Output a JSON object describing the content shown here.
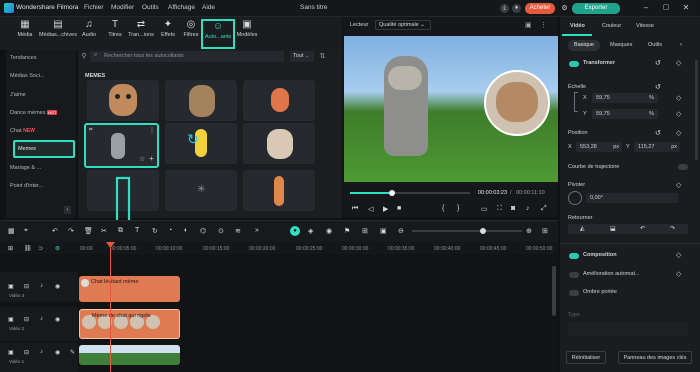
{
  "titlebar": {
    "app_name": "Wondershare Filmora",
    "menus": [
      "Fichier",
      "Modifier",
      "Outils",
      "Affichage",
      "Aide"
    ],
    "doc_title": "Sans titre",
    "buy_label": "Acheter",
    "account_label": "Exporter"
  },
  "toolbar": {
    "items": [
      "Média",
      "Médias...chives",
      "Audio",
      "Titres",
      "Tran...ions",
      "Effets",
      "Filtres",
      "Auto...ants",
      "Modèles"
    ]
  },
  "leftnav": {
    "items": [
      "Tendances",
      "Médias Soci...",
      "J'aime",
      "Dance mèmes",
      "Chat",
      "Memes",
      "Mariage & ...",
      "Point d'inter..."
    ],
    "new_badge": "NEW",
    "hot_badge": "HOT"
  },
  "content": {
    "search_placeholder": "Rechercher tous les autocollants",
    "filter_label": "Tout",
    "section_label": "MEMES"
  },
  "preview": {
    "player_label": "Lecteur",
    "quality_label": "Qualité optimale",
    "current_time": "00:00:03:23",
    "total_time": "00:00:11:10",
    "progress": 0.35
  },
  "right": {
    "tabs": [
      "Vidéo",
      "Couleur",
      "Vitesse"
    ],
    "subtabs": [
      "Basique",
      "Masques",
      "Outils"
    ],
    "transformer_label": "Transformer",
    "scale_label": "Échelle",
    "scale_x_label": "X",
    "scale_x": "59,75",
    "scale_y_label": "Y",
    "scale_y": "59,75",
    "percent": "%",
    "position_label": "Position",
    "pos_x_label": "X",
    "pos_x": "553,28",
    "pos_y_label": "Y",
    "pos_y": "115,27",
    "px": "px",
    "trajectory_label": "Courbe de trajectoire",
    "rotate_label": "Pivoter",
    "rotate_value": "0,00°",
    "flip_label": "Retourner",
    "composition_label": "Composition",
    "auto_enhance_label": "Amélioration automat...",
    "drop_shadow_label": "Ombre portée",
    "type_label": "Type",
    "reset_label": "Réinitialiser",
    "keyframe_label": "Panneau des images clés"
  },
  "timeline": {
    "ticks": [
      "00:00",
      "00:00:05:00",
      "00:00:10:00",
      "00:00:15:00",
      "00:00:20:00",
      "00:00:25:00",
      "00:00:30:00",
      "00:00:35:00",
      "00:00:40:00",
      "00:00:45:00",
      "00:00:50:00"
    ],
    "tracks": [
      {
        "label": "Vidéo 3",
        "clip": "Chat lévitant mème"
      },
      {
        "label": "Vidéo 2",
        "clip": "Mème de chat qui rigole"
      },
      {
        "label": "Vidéo 1",
        "clip": ""
      }
    ]
  },
  "colors": {
    "accent": "#2de0c2",
    "buy": "#e55a3c",
    "clip_orange": "#e07a52",
    "clip_green": "#3f7f3a"
  }
}
